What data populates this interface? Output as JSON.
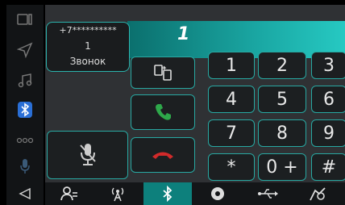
{
  "call": {
    "dialed_text": "1",
    "contact_number": "+7**********",
    "contact_index": "1",
    "call_label": "Звонок"
  },
  "keypad": {
    "keys": [
      "1",
      "2",
      "3",
      "4",
      "5",
      "6",
      "7",
      "8",
      "9",
      "*",
      "0 +",
      "#"
    ]
  },
  "sidebar": {
    "icons": [
      "screen-icon",
      "navigation-icon",
      "music-icon",
      "bluetooth-icon",
      "more-icon",
      "microphone-icon",
      "back-icon"
    ]
  },
  "tabs": {
    "items": [
      "contacts-icon",
      "radio-icon",
      "bluetooth-icon",
      "disc-icon",
      "usb-icon",
      "car-settings-icon"
    ],
    "active": "bluetooth-icon"
  },
  "colors": {
    "accent": "#1aa7a3",
    "call_green": "#2ea84a",
    "hangup_red": "#d12a2a",
    "bluetooth_blue": "#2a6fd6"
  }
}
